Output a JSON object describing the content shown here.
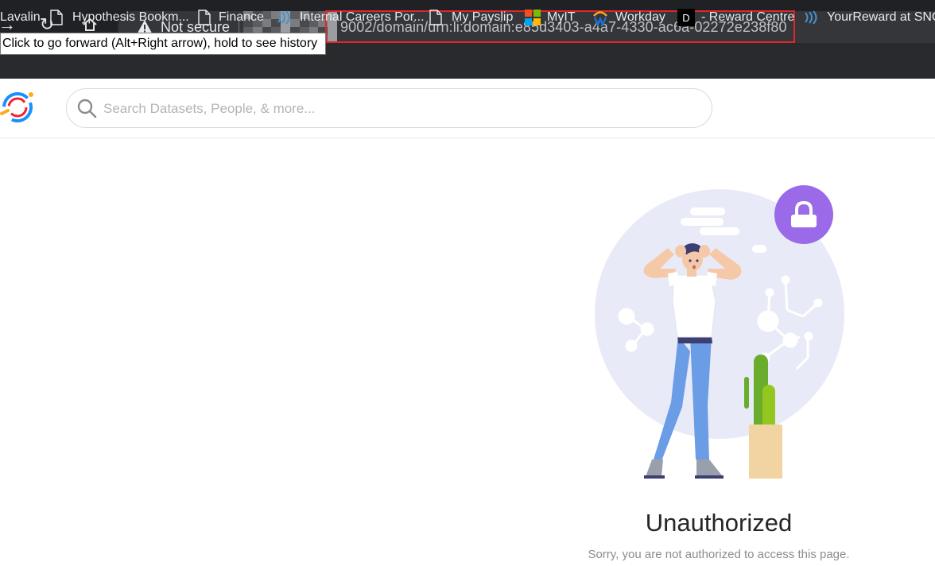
{
  "browser": {
    "security_label": "Not secure",
    "url_visible": "9002/domain/urn:li:domain:e85d3403-a4a7-4330-ac6a-02272e238f80",
    "tooltip": "Click to go forward (Alt+Right arrow), hold to see history",
    "highlight_color": "#e0262b"
  },
  "bookmarks": [
    {
      "label": "Lavalin",
      "icon": "none"
    },
    {
      "label": "Hypothesis Bookm...",
      "icon": "page-icon"
    },
    {
      "label": "Finance",
      "icon": "page-icon"
    },
    {
      "label": "Internal Careers Por...",
      "icon": "wave-icon"
    },
    {
      "label": "My Payslip",
      "icon": "page-icon"
    },
    {
      "label": "MyIT",
      "icon": "microsoft-icon"
    },
    {
      "label": "Workday",
      "icon": "workday-icon"
    },
    {
      "label": "- Reward Centre",
      "icon": "d-icon"
    },
    {
      "label": "YourReward at SNC...",
      "icon": "wave-icon"
    }
  ],
  "search": {
    "placeholder": "Search Datasets, People, & more..."
  },
  "error": {
    "title": "Unauthorized",
    "description": "Sorry, you are not authorized to access this page."
  },
  "colors": {
    "lock_badge": "#9b6ae8",
    "circle_bg": "#e8ebf7",
    "cactus": "#7dbb2c",
    "pot": "#f2d4a2",
    "jeans": "#6b9ce6"
  }
}
